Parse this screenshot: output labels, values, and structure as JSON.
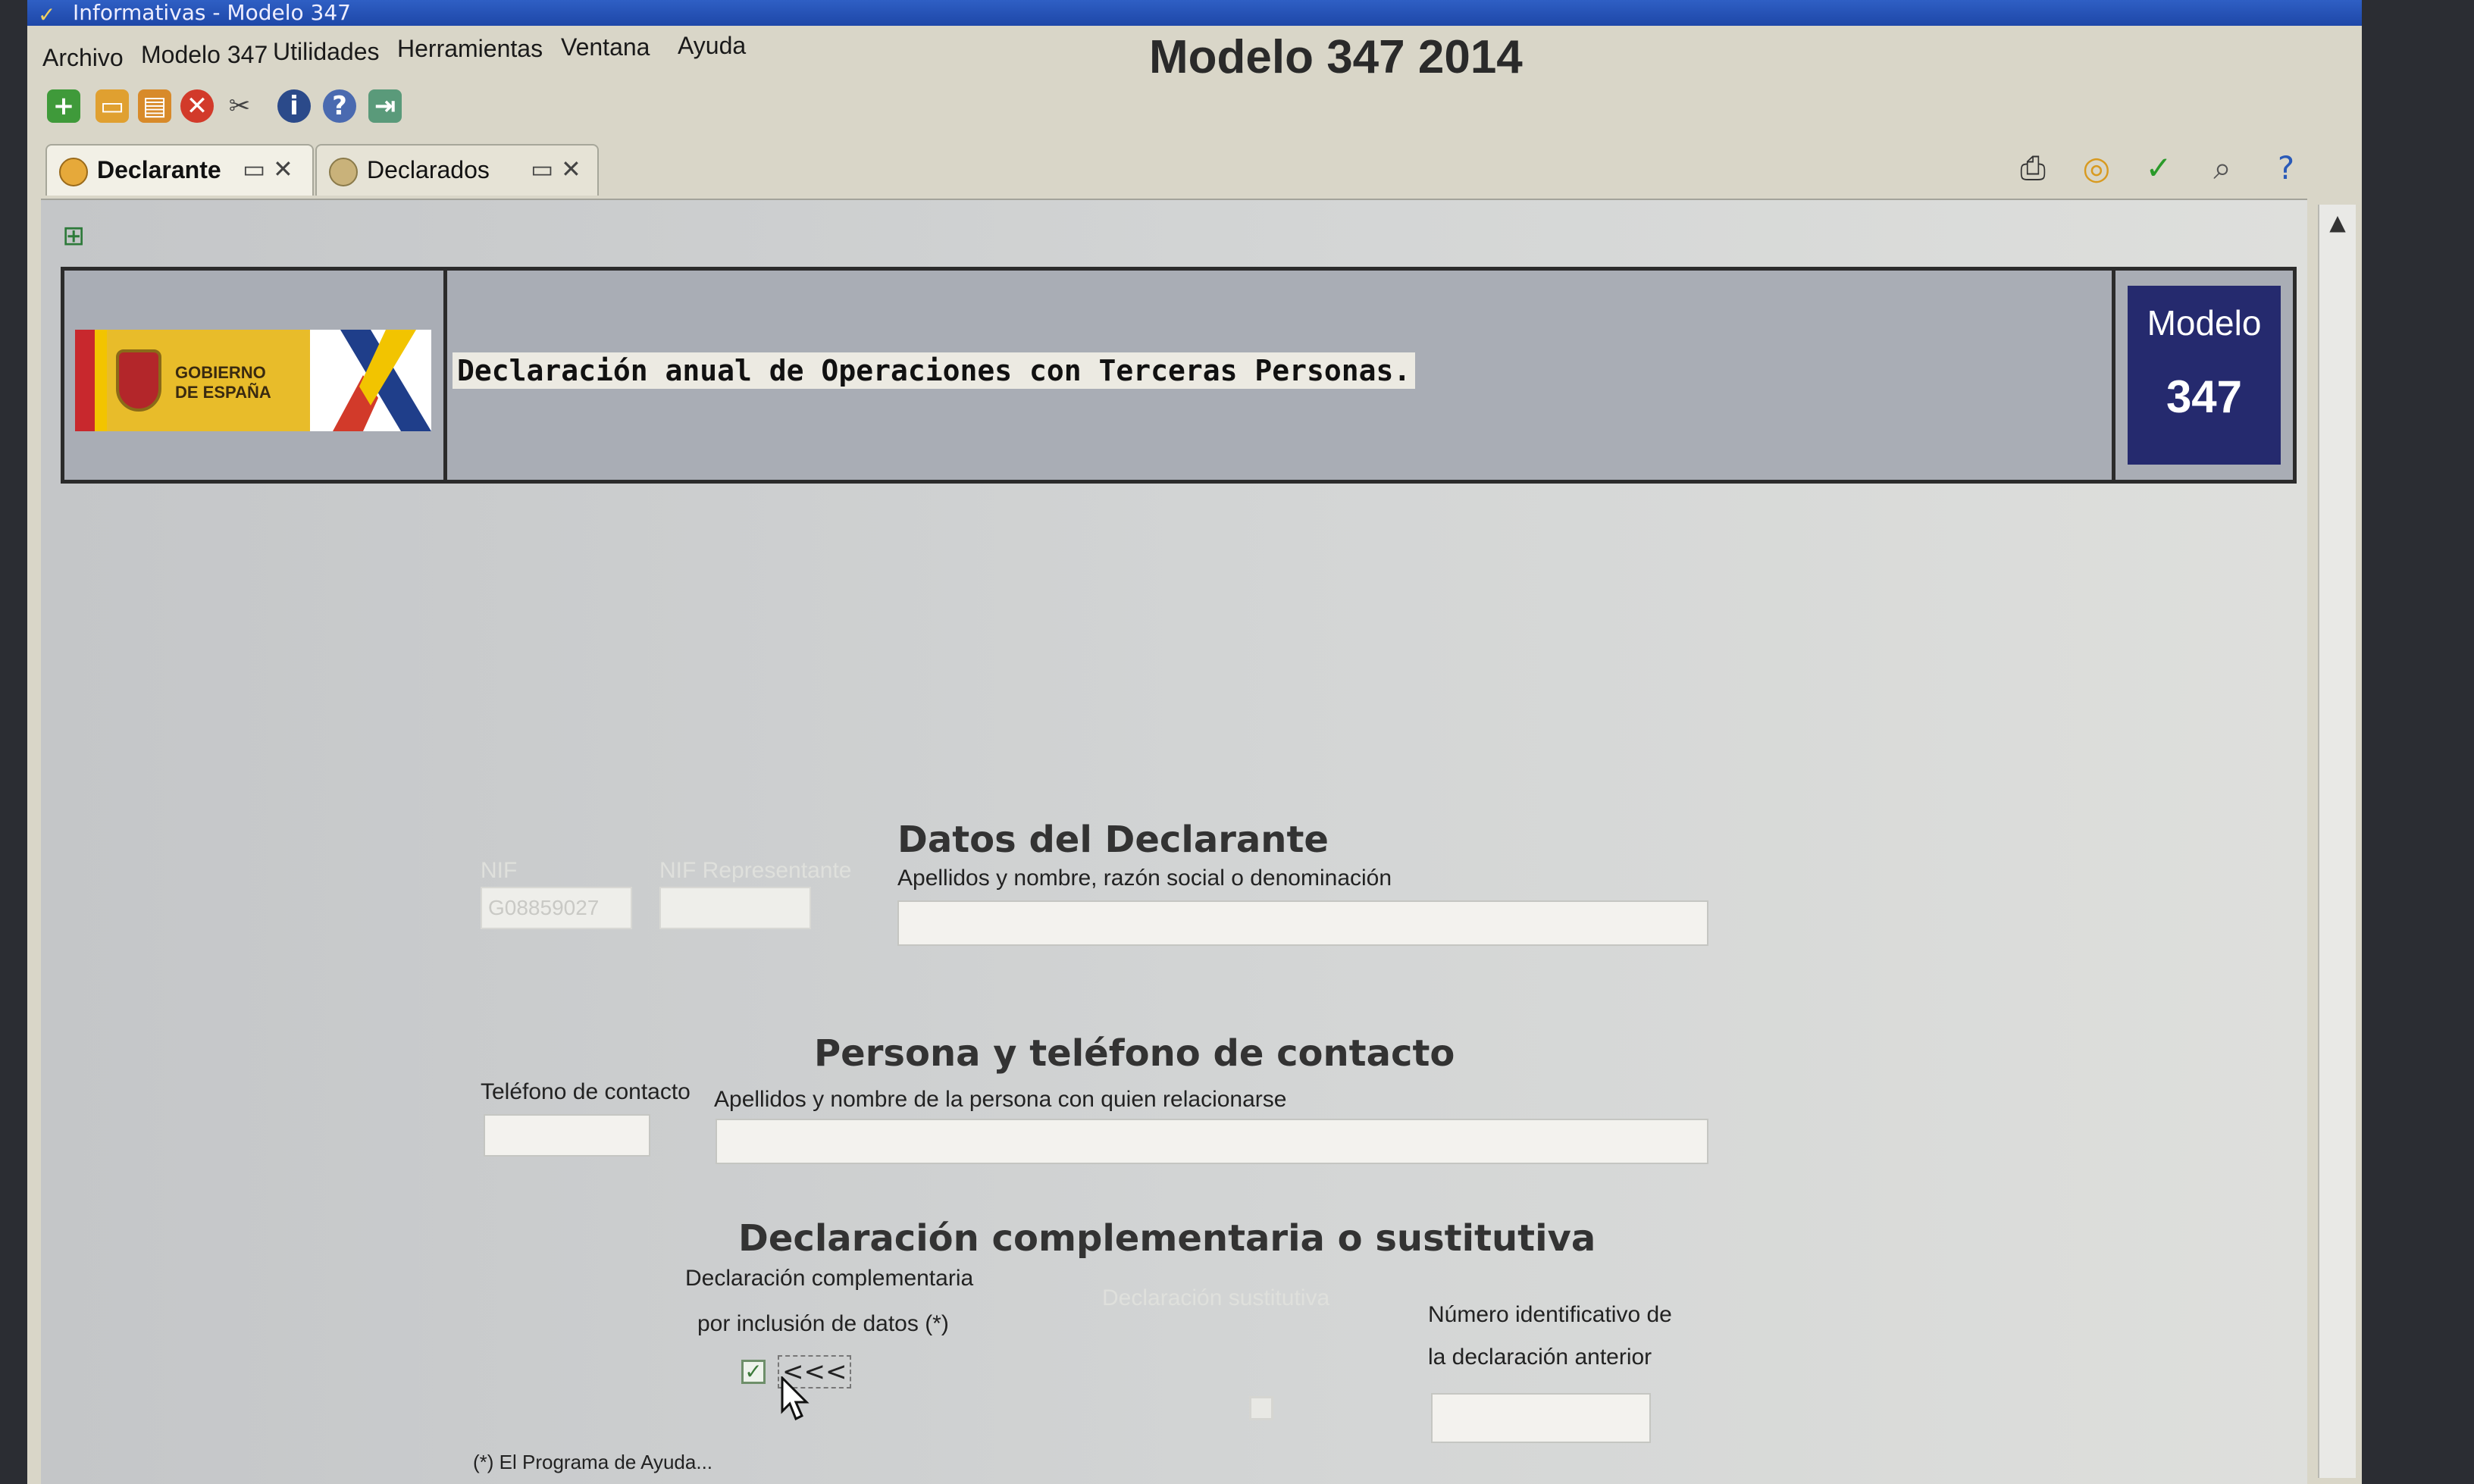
{
  "window": {
    "title": "Informativas - Modelo 347"
  },
  "menu": [
    "Archivo",
    "Modelo 347",
    "Utilidades",
    "Herramientas",
    "Ventana",
    "Ayuda"
  ],
  "app_title": "Modelo 347 2014",
  "toolbar_icons": [
    "add-icon",
    "open-folder-icon",
    "save-icon",
    "delete-icon",
    "tools-icon",
    "info-icon",
    "help-icon",
    "exit-icon"
  ],
  "tabs": [
    {
      "label": "Declarante",
      "active": true
    },
    {
      "label": "Declarados",
      "active": false
    }
  ],
  "right_tools": [
    "print-icon",
    "copy-icon",
    "validate-icon",
    "search-icon",
    "help-icon"
  ],
  "header": {
    "logo_text_1": "GOBIERNO",
    "logo_text_2": "DE ESPAÑA",
    "title": "Declaración anual de Operaciones con Terceras Personas.",
    "modelo_label": "Modelo",
    "modelo_number": "347"
  },
  "declarante": {
    "section_title": "Datos del Declarante",
    "nif_label": "NIF",
    "nif_value": "G08859027",
    "nif_rep_label": "NIF Representante",
    "name_label": "Apellidos y nombre,  razón social o denominación",
    "name_value": ""
  },
  "contacto": {
    "section_title": "Persona y teléfono de contacto",
    "phone_label": "Teléfono de contacto",
    "phone_value": "",
    "person_label": "Apellidos y nombre de la persona con quien relacionarse",
    "person_value": ""
  },
  "complementaria": {
    "section_title": "Declaración complementaria o sustitutiva",
    "comp_label_1": "Declaración complementaria",
    "comp_label_2": "por inclusión de datos (*)",
    "comp_checked": true,
    "arrows": "<<<",
    "sustitutiva_label": "Declaración sustitutiva",
    "prev_num_label_1": "Número identificativo de",
    "prev_num_label_2": "la declaración anterior",
    "prev_num_value": ""
  },
  "footnote": "(*) El Programa de Ayuda..."
}
